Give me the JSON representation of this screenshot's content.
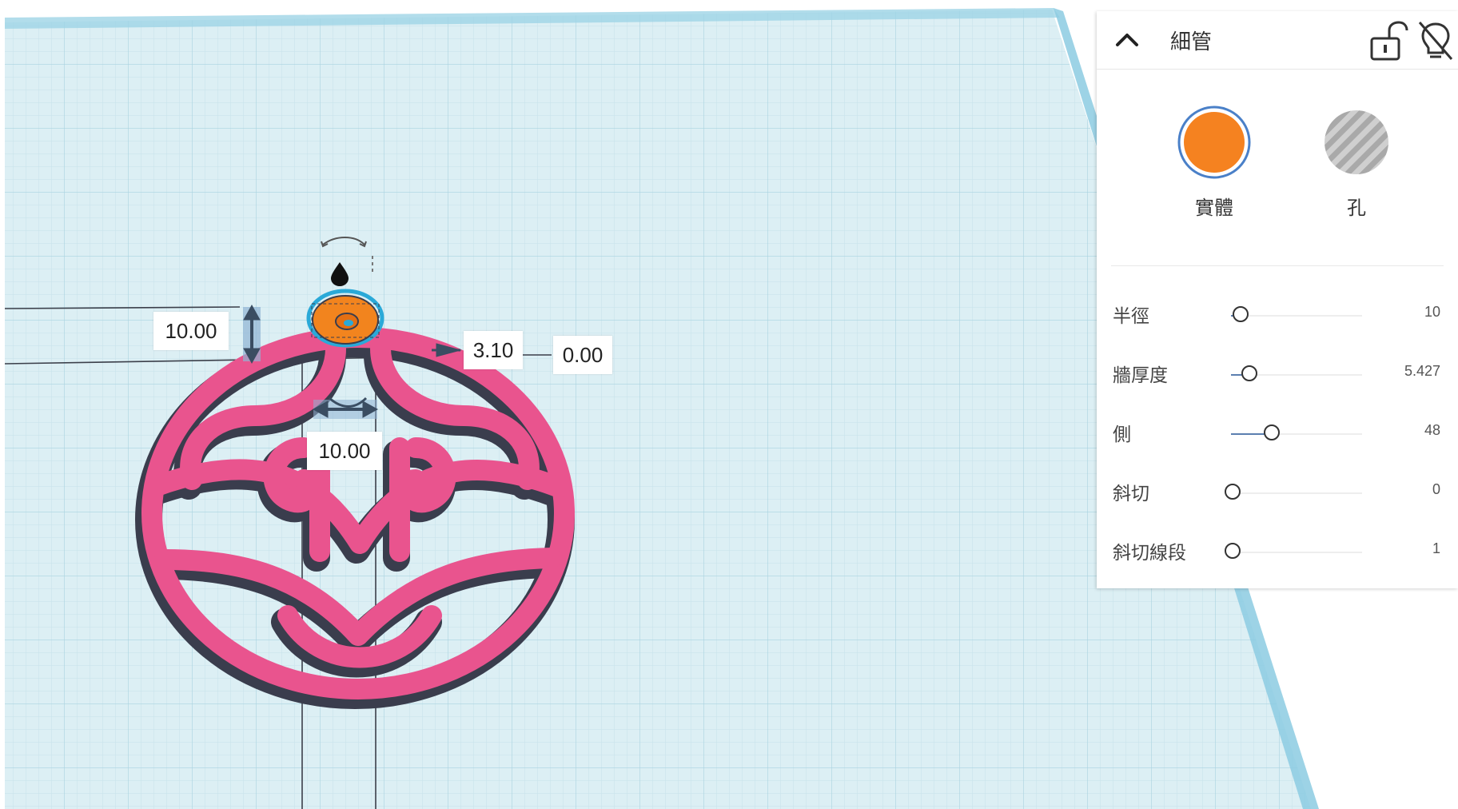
{
  "viewport": {
    "dimensions": {
      "height": "10.00",
      "offset": "3.10",
      "elevation": "0.00",
      "width": "10.00"
    },
    "colors": {
      "grid_bg": "#d6ecf2",
      "grid_line": "#bfe0ea",
      "grid_edge": "#8fcde3",
      "model": "#e9548e",
      "model_edge": "#3a3d4d",
      "selected": "#f2841e",
      "selection_outline": "#2aa9d8"
    }
  },
  "panel": {
    "title": "細管",
    "modes": [
      {
        "label": "實體",
        "selected": true,
        "color": "#f58220"
      },
      {
        "label": "孔",
        "selected": false,
        "color": "#b5b5b5"
      }
    ],
    "params": [
      {
        "label": "半徑",
        "value": "10",
        "fraction": 0.06
      },
      {
        "label": "牆厚度",
        "value": "5.427",
        "fraction": 0.13
      },
      {
        "label": "側",
        "value": "48",
        "fraction": 0.3
      },
      {
        "label": "斜切",
        "value": "0",
        "fraction": 0.0
      },
      {
        "label": "斜切線段",
        "value": "1",
        "fraction": 0.0
      }
    ]
  }
}
